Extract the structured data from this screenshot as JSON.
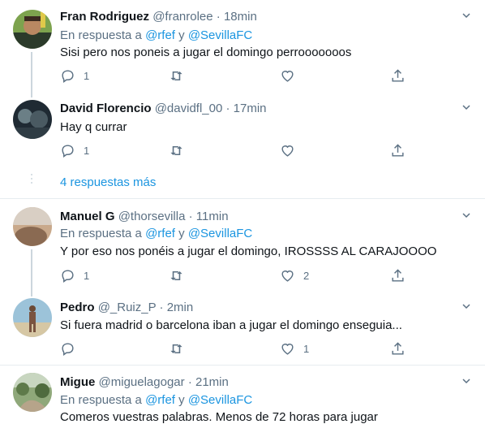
{
  "tweets": [
    {
      "name": "Fran Rodriguez",
      "handle": "@franrolee",
      "time": "18min",
      "reply_prefix": "En respuesta a",
      "reply_user1": "@rfef",
      "reply_and": "y",
      "reply_user2": "@SevillaFC",
      "text": "Sisi pero nos poneis a jugar el domingo perrooooooos",
      "replies": "1",
      "retweets": "",
      "likes": ""
    },
    {
      "name": "David Florencio",
      "handle": "@davidfl_00",
      "time": "17min",
      "text": "Hay q currar",
      "replies": "1",
      "retweets": "",
      "likes": ""
    },
    {
      "name": "Manuel G",
      "handle": "@thorsevilla",
      "time": "11min",
      "reply_prefix": "En respuesta a",
      "reply_user1": "@rfef",
      "reply_and": "y",
      "reply_user2": "@SevillaFC",
      "text": "Y por eso nos ponéis a jugar el domingo,  IROSSSS AL CARAJOOOO",
      "replies": "1",
      "retweets": "",
      "likes": "2"
    },
    {
      "name": "Pedro",
      "handle": "@_Ruiz_P",
      "time": "2min",
      "text": "Si fuera madrid o barcelona iban a jugar el domingo enseguia...",
      "replies": "",
      "retweets": "",
      "likes": "1"
    },
    {
      "name": "Migue",
      "handle": "@miguelagogar",
      "time": "21min",
      "reply_prefix": "En respuesta a",
      "reply_user1": "@rfef",
      "reply_and": "y",
      "reply_user2": "@SevillaFC",
      "text": "Comeros vuestras palabras. Menos de 72 horas para jugar"
    }
  ],
  "more_replies": "4 respuestas más",
  "separator": "·",
  "colors": {
    "accent": "#1b95e0",
    "muted": "#5b7083",
    "divider": "#e6ecf0"
  }
}
